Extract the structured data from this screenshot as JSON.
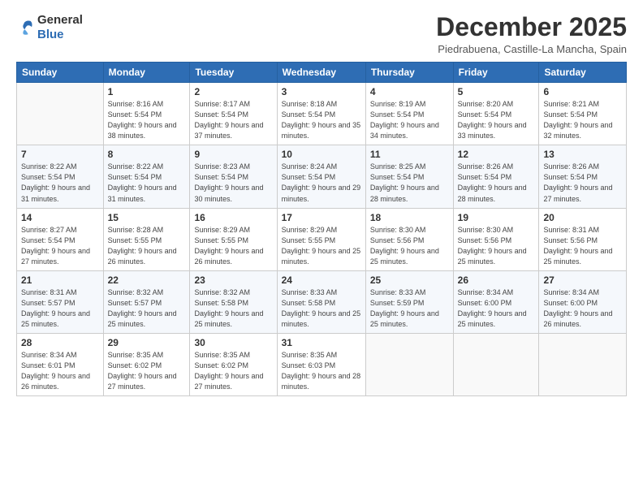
{
  "logo": {
    "general": "General",
    "blue": "Blue"
  },
  "header": {
    "month": "December 2025",
    "location": "Piedrabuena, Castille-La Mancha, Spain"
  },
  "weekdays": [
    "Sunday",
    "Monday",
    "Tuesday",
    "Wednesday",
    "Thursday",
    "Friday",
    "Saturday"
  ],
  "weeks": [
    [
      {
        "day": "",
        "sunrise": "",
        "sunset": "",
        "daylight": "",
        "empty": true
      },
      {
        "day": "1",
        "sunrise": "Sunrise: 8:16 AM",
        "sunset": "Sunset: 5:54 PM",
        "daylight": "Daylight: 9 hours and 38 minutes."
      },
      {
        "day": "2",
        "sunrise": "Sunrise: 8:17 AM",
        "sunset": "Sunset: 5:54 PM",
        "daylight": "Daylight: 9 hours and 37 minutes."
      },
      {
        "day": "3",
        "sunrise": "Sunrise: 8:18 AM",
        "sunset": "Sunset: 5:54 PM",
        "daylight": "Daylight: 9 hours and 35 minutes."
      },
      {
        "day": "4",
        "sunrise": "Sunrise: 8:19 AM",
        "sunset": "Sunset: 5:54 PM",
        "daylight": "Daylight: 9 hours and 34 minutes."
      },
      {
        "day": "5",
        "sunrise": "Sunrise: 8:20 AM",
        "sunset": "Sunset: 5:54 PM",
        "daylight": "Daylight: 9 hours and 33 minutes."
      },
      {
        "day": "6",
        "sunrise": "Sunrise: 8:21 AM",
        "sunset": "Sunset: 5:54 PM",
        "daylight": "Daylight: 9 hours and 32 minutes."
      }
    ],
    [
      {
        "day": "7",
        "sunrise": "Sunrise: 8:22 AM",
        "sunset": "Sunset: 5:54 PM",
        "daylight": "Daylight: 9 hours and 31 minutes."
      },
      {
        "day": "8",
        "sunrise": "Sunrise: 8:22 AM",
        "sunset": "Sunset: 5:54 PM",
        "daylight": "Daylight: 9 hours and 31 minutes."
      },
      {
        "day": "9",
        "sunrise": "Sunrise: 8:23 AM",
        "sunset": "Sunset: 5:54 PM",
        "daylight": "Daylight: 9 hours and 30 minutes."
      },
      {
        "day": "10",
        "sunrise": "Sunrise: 8:24 AM",
        "sunset": "Sunset: 5:54 PM",
        "daylight": "Daylight: 9 hours and 29 minutes."
      },
      {
        "day": "11",
        "sunrise": "Sunrise: 8:25 AM",
        "sunset": "Sunset: 5:54 PM",
        "daylight": "Daylight: 9 hours and 28 minutes."
      },
      {
        "day": "12",
        "sunrise": "Sunrise: 8:26 AM",
        "sunset": "Sunset: 5:54 PM",
        "daylight": "Daylight: 9 hours and 28 minutes."
      },
      {
        "day": "13",
        "sunrise": "Sunrise: 8:26 AM",
        "sunset": "Sunset: 5:54 PM",
        "daylight": "Daylight: 9 hours and 27 minutes."
      }
    ],
    [
      {
        "day": "14",
        "sunrise": "Sunrise: 8:27 AM",
        "sunset": "Sunset: 5:54 PM",
        "daylight": "Daylight: 9 hours and 27 minutes."
      },
      {
        "day": "15",
        "sunrise": "Sunrise: 8:28 AM",
        "sunset": "Sunset: 5:55 PM",
        "daylight": "Daylight: 9 hours and 26 minutes."
      },
      {
        "day": "16",
        "sunrise": "Sunrise: 8:29 AM",
        "sunset": "Sunset: 5:55 PM",
        "daylight": "Daylight: 9 hours and 26 minutes."
      },
      {
        "day": "17",
        "sunrise": "Sunrise: 8:29 AM",
        "sunset": "Sunset: 5:55 PM",
        "daylight": "Daylight: 9 hours and 25 minutes."
      },
      {
        "day": "18",
        "sunrise": "Sunrise: 8:30 AM",
        "sunset": "Sunset: 5:56 PM",
        "daylight": "Daylight: 9 hours and 25 minutes."
      },
      {
        "day": "19",
        "sunrise": "Sunrise: 8:30 AM",
        "sunset": "Sunset: 5:56 PM",
        "daylight": "Daylight: 9 hours and 25 minutes."
      },
      {
        "day": "20",
        "sunrise": "Sunrise: 8:31 AM",
        "sunset": "Sunset: 5:56 PM",
        "daylight": "Daylight: 9 hours and 25 minutes."
      }
    ],
    [
      {
        "day": "21",
        "sunrise": "Sunrise: 8:31 AM",
        "sunset": "Sunset: 5:57 PM",
        "daylight": "Daylight: 9 hours and 25 minutes."
      },
      {
        "day": "22",
        "sunrise": "Sunrise: 8:32 AM",
        "sunset": "Sunset: 5:57 PM",
        "daylight": "Daylight: 9 hours and 25 minutes."
      },
      {
        "day": "23",
        "sunrise": "Sunrise: 8:32 AM",
        "sunset": "Sunset: 5:58 PM",
        "daylight": "Daylight: 9 hours and 25 minutes."
      },
      {
        "day": "24",
        "sunrise": "Sunrise: 8:33 AM",
        "sunset": "Sunset: 5:58 PM",
        "daylight": "Daylight: 9 hours and 25 minutes."
      },
      {
        "day": "25",
        "sunrise": "Sunrise: 8:33 AM",
        "sunset": "Sunset: 5:59 PM",
        "daylight": "Daylight: 9 hours and 25 minutes."
      },
      {
        "day": "26",
        "sunrise": "Sunrise: 8:34 AM",
        "sunset": "Sunset: 6:00 PM",
        "daylight": "Daylight: 9 hours and 25 minutes."
      },
      {
        "day": "27",
        "sunrise": "Sunrise: 8:34 AM",
        "sunset": "Sunset: 6:00 PM",
        "daylight": "Daylight: 9 hours and 26 minutes."
      }
    ],
    [
      {
        "day": "28",
        "sunrise": "Sunrise: 8:34 AM",
        "sunset": "Sunset: 6:01 PM",
        "daylight": "Daylight: 9 hours and 26 minutes."
      },
      {
        "day": "29",
        "sunrise": "Sunrise: 8:35 AM",
        "sunset": "Sunset: 6:02 PM",
        "daylight": "Daylight: 9 hours and 27 minutes."
      },
      {
        "day": "30",
        "sunrise": "Sunrise: 8:35 AM",
        "sunset": "Sunset: 6:02 PM",
        "daylight": "Daylight: 9 hours and 27 minutes."
      },
      {
        "day": "31",
        "sunrise": "Sunrise: 8:35 AM",
        "sunset": "Sunset: 6:03 PM",
        "daylight": "Daylight: 9 hours and 28 minutes."
      },
      {
        "day": "",
        "sunrise": "",
        "sunset": "",
        "daylight": "",
        "empty": true
      },
      {
        "day": "",
        "sunrise": "",
        "sunset": "",
        "daylight": "",
        "empty": true
      },
      {
        "day": "",
        "sunrise": "",
        "sunset": "",
        "daylight": "",
        "empty": true
      }
    ]
  ]
}
